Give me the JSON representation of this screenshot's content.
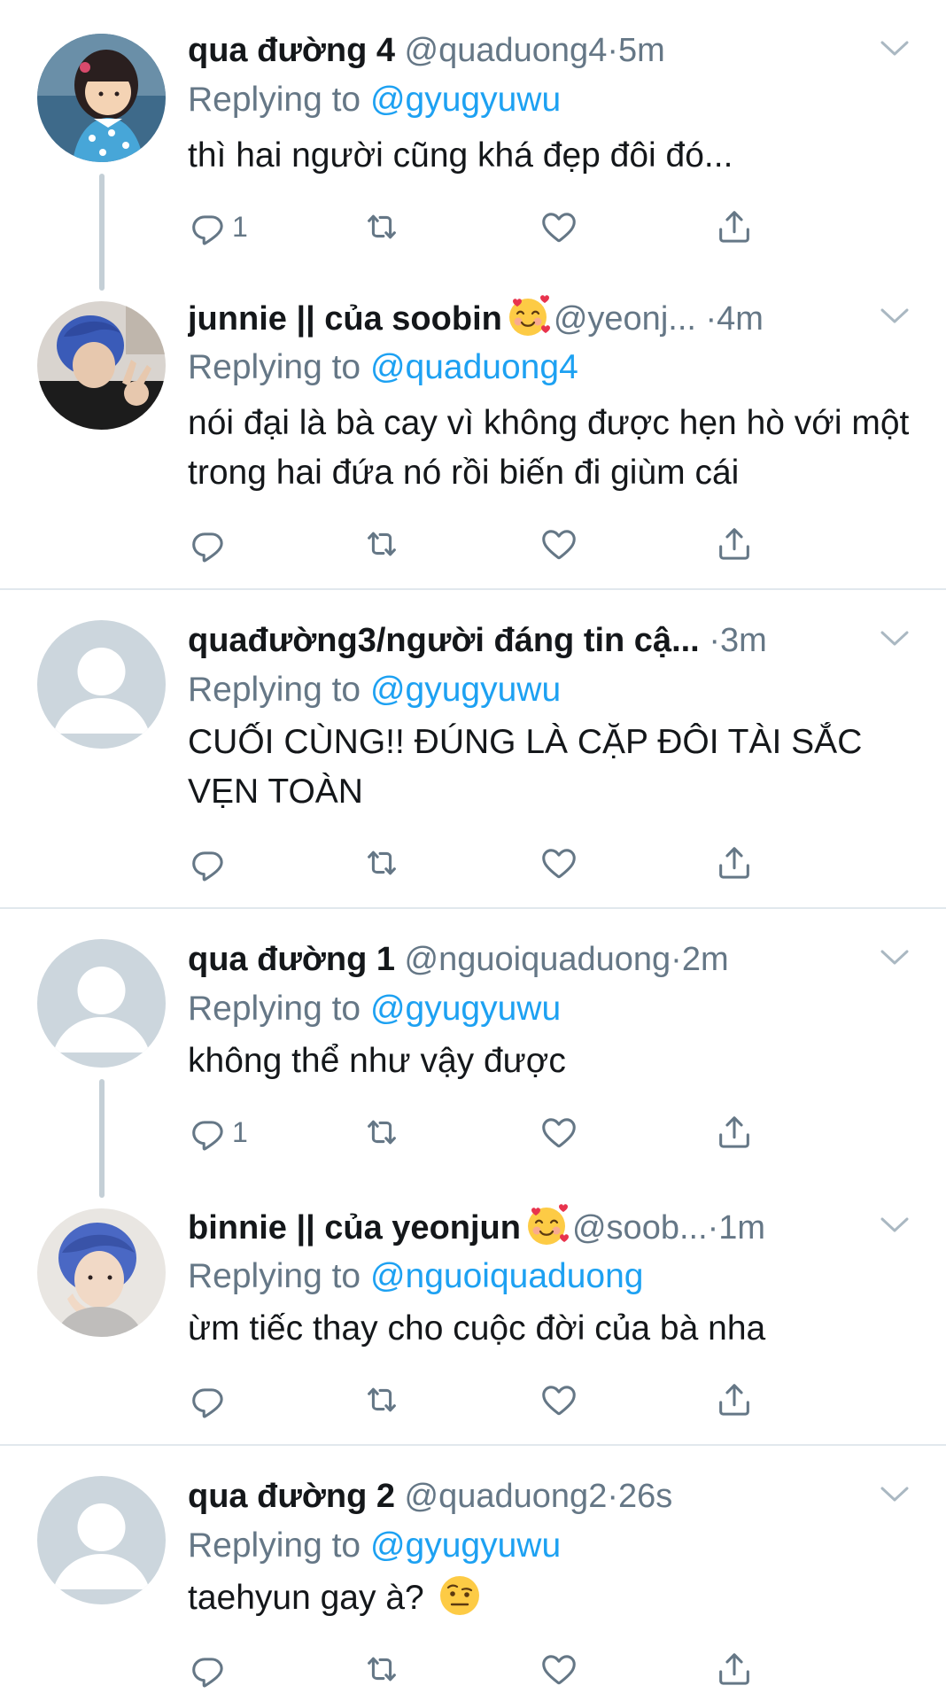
{
  "colors": {
    "text": "#14171a",
    "secondary": "#657786",
    "link": "#1da1f2",
    "thread_line": "#c4cfd6",
    "divider": "#e1e8ed"
  },
  "tweets": [
    {
      "name": "qua đường 4",
      "handle": "@quaduong4",
      "dot": "·",
      "time": "5m",
      "replying_prefix": "Replying to ",
      "replying_to": "@gyugyuwu",
      "text": "thì hai người cũng khá đẹp đôi đó...",
      "reply_count": "1",
      "avatar": "cartoon-girl-avatar"
    },
    {
      "name": "junnie || của soobin",
      "emoji": "smiling-face-with-hearts",
      "handle": "@yeonj...",
      "dot": "·",
      "time": "4m",
      "replying_prefix": "Replying to ",
      "replying_to": "@quaduong4",
      "text": "nói đại là bà cay vì không được hẹn hò với một trong hai đứa nó rồi biến đi giùm cái",
      "reply_count": "",
      "avatar": "blue-hair-photo-avatar"
    },
    {
      "name": "quađường3/người đáng tin cậ...",
      "handle": "",
      "dot": "·",
      "time": "3m",
      "replying_prefix": "Replying to ",
      "replying_to": "@gyugyuwu",
      "text": "CUỐI CÙNG!! ĐÚNG LÀ CẶP ĐÔI TÀI SẮC VẸN TOÀN",
      "reply_count": "",
      "avatar": "default-avatar"
    },
    {
      "name": "qua đường 1",
      "handle": "@nguoiquaduong",
      "dot": "·",
      "time": "2m",
      "replying_prefix": "Replying to ",
      "replying_to": "@gyugyuwu",
      "text": "không thể như vậy được",
      "reply_count": "1",
      "avatar": "default-avatar"
    },
    {
      "name": "binnie || của yeonjun",
      "emoji": "smiling-face-with-hearts",
      "handle": "@soob...",
      "dot": "·",
      "time": "1m",
      "replying_prefix": "Replying to ",
      "replying_to": "@nguoiquaduong",
      "text": "ừm tiếc thay cho cuộc đời của bà nha",
      "reply_count": "",
      "avatar": "blue-hair-photo-avatar"
    },
    {
      "name": "qua đường 2",
      "handle": "@quaduong2",
      "dot": "·",
      "time": "26s",
      "replying_prefix": "Replying to ",
      "replying_to": "@gyugyuwu",
      "text": "taehyun gay à?",
      "text_emoji": "face-with-raised-eyebrow",
      "reply_count": "",
      "avatar": "default-avatar"
    }
  ]
}
